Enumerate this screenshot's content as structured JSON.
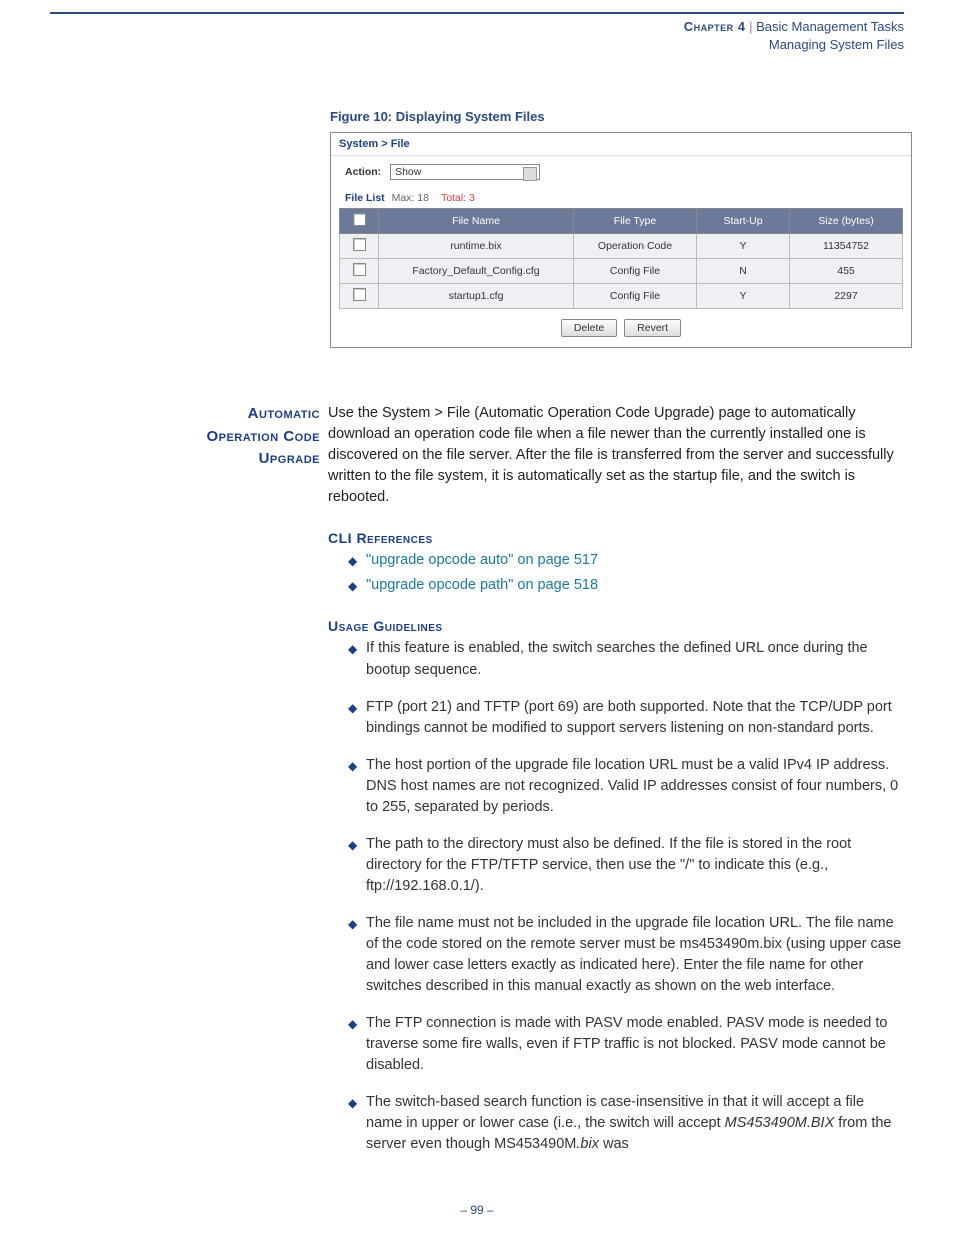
{
  "header": {
    "chapter_label": "Chapter 4",
    "separator": " |  ",
    "title": "Basic Management Tasks",
    "subtitle": "Managing System Files"
  },
  "figure": {
    "caption": "Figure 10:  Displaying System Files"
  },
  "screenshot": {
    "breadcrumb_a": "System",
    "breadcrumb_sep": " > ",
    "breadcrumb_b": "File",
    "action_label": "Action:",
    "action_value": "Show",
    "filelist_label": "File List",
    "filelist_max": "  Max: 18",
    "filelist_total": "Total: 3",
    "columns": [
      "",
      "File Name",
      "File Type",
      "Start-Up",
      "Size (bytes)"
    ],
    "rows": [
      {
        "name": "runtime.bix",
        "type": "Operation Code",
        "startup": "Y",
        "size": "11354752"
      },
      {
        "name": "Factory_Default_Config.cfg",
        "type": "Config File",
        "startup": "N",
        "size": "455"
      },
      {
        "name": "startup1.cfg",
        "type": "Config File",
        "startup": "Y",
        "size": "2297"
      }
    ],
    "btn_delete": "Delete",
    "btn_revert": "Revert"
  },
  "section": {
    "sidehead_l1": "Automatic",
    "sidehead_l2": "Operation Code",
    "sidehead_l3": "Upgrade",
    "intro": "Use the System > File (Automatic Operation Code Upgrade) page to automatically download an operation code file when a file newer than the currently installed one is discovered on the file server. After the file is transferred from the server and successfully written to the file system, it is automatically set as the startup file, and the switch is rebooted."
  },
  "cli": {
    "heading": "CLI References",
    "items": [
      "\"upgrade opcode auto\" on page 517",
      "\"upgrade opcode path\" on page 518"
    ]
  },
  "usage": {
    "heading": "Usage Guidelines",
    "items": [
      "If this feature is enabled, the switch searches the defined URL once during the bootup sequence.",
      "FTP (port 21) and TFTP (port 69) are both supported. Note that the TCP/UDP port bindings cannot be modified to support servers listening on non-standard ports.",
      "The host portion of the upgrade file location URL must be a valid IPv4 IP address. DNS host names are not recognized. Valid IP addresses consist of four numbers, 0 to 255, separated by periods.",
      "The path to the directory must also be defined. If the file is stored in the root directory for the FTP/TFTP service, then use the \"/\" to indicate this (e.g., ftp://192.168.0.1/).",
      "The file name must not be included in the upgrade file location URL. The file name of the code stored on the remote server must be ms453490m.bix (using upper case and lower case letters exactly as indicated here). Enter the file name for other switches described in this manual exactly as shown on the web interface.",
      "The FTP connection is made with PASV mode enabled. PASV mode is needed to traverse some fire walls, even if FTP traffic is not blocked. PASV mode cannot be disabled."
    ],
    "last_item_pre": "The switch-based search function is case-insensitive in that it will accept a file name in upper or lower case (i.e., the switch will accept ",
    "last_item_em1": "MS453490M.BIX",
    "last_item_mid": " from the server even though MS453490M",
    "last_item_em2": ".bix",
    "last_item_post": " was"
  },
  "pagenum": "–  99  –"
}
